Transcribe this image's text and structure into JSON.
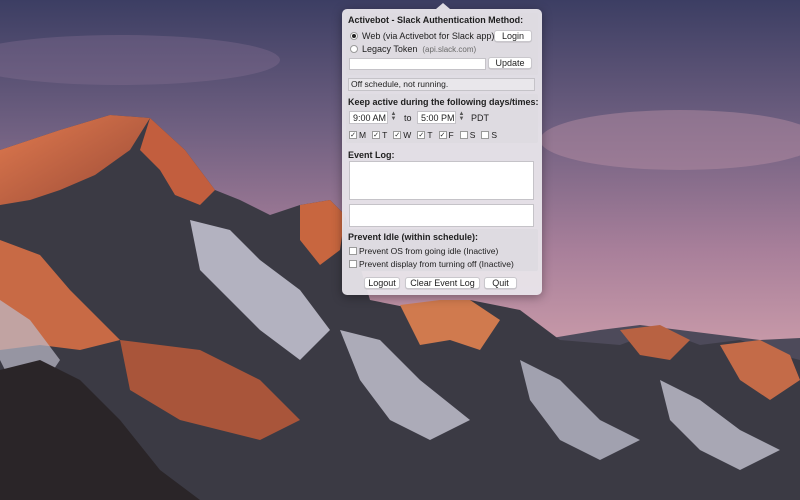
{
  "colors": {
    "sky_top": "#3c3e63",
    "sky_mid": "#a87f9a",
    "sky_low": "#d2a2ad",
    "mountain_lit": "#d26a45",
    "mountain_shadow": "#3b3a44",
    "snow": "#c9c8d6"
  },
  "popover": {
    "auth": {
      "title": "Activebot - Slack Authentication Method:",
      "option_web": "Web (via Activebot for Slack app)",
      "option_web_selected": true,
      "option_legacy": "Legacy Token",
      "legacy_hint": "(api.slack.com)",
      "login_label": "Login",
      "token_value": "",
      "update_label": "Update"
    },
    "status_text": "Off schedule, not running.",
    "schedule": {
      "title": "Keep active during the following days/times:",
      "start_time": "9:00 AM",
      "to_label": "to",
      "end_time": "5:00 PM",
      "timezone": "PDT",
      "days": [
        {
          "label": "M",
          "checked": true
        },
        {
          "label": "T",
          "checked": true
        },
        {
          "label": "W",
          "checked": true
        },
        {
          "label": "T",
          "checked": true
        },
        {
          "label": "F",
          "checked": true
        },
        {
          "label": "S",
          "checked": false
        },
        {
          "label": "S",
          "checked": false
        }
      ]
    },
    "event_log": {
      "title": "Event Log:",
      "log_text": "",
      "detail_text": ""
    },
    "idle": {
      "title": "Prevent Idle (within schedule):",
      "prevent_os": "Prevent OS from going idle (Inactive)",
      "prevent_os_checked": false,
      "prevent_display": "Prevent display from turning off (Inactive)",
      "prevent_display_checked": false
    },
    "footer": {
      "logout_label": "Logout",
      "clear_label": "Clear Event Log",
      "quit_label": "Quit"
    }
  }
}
